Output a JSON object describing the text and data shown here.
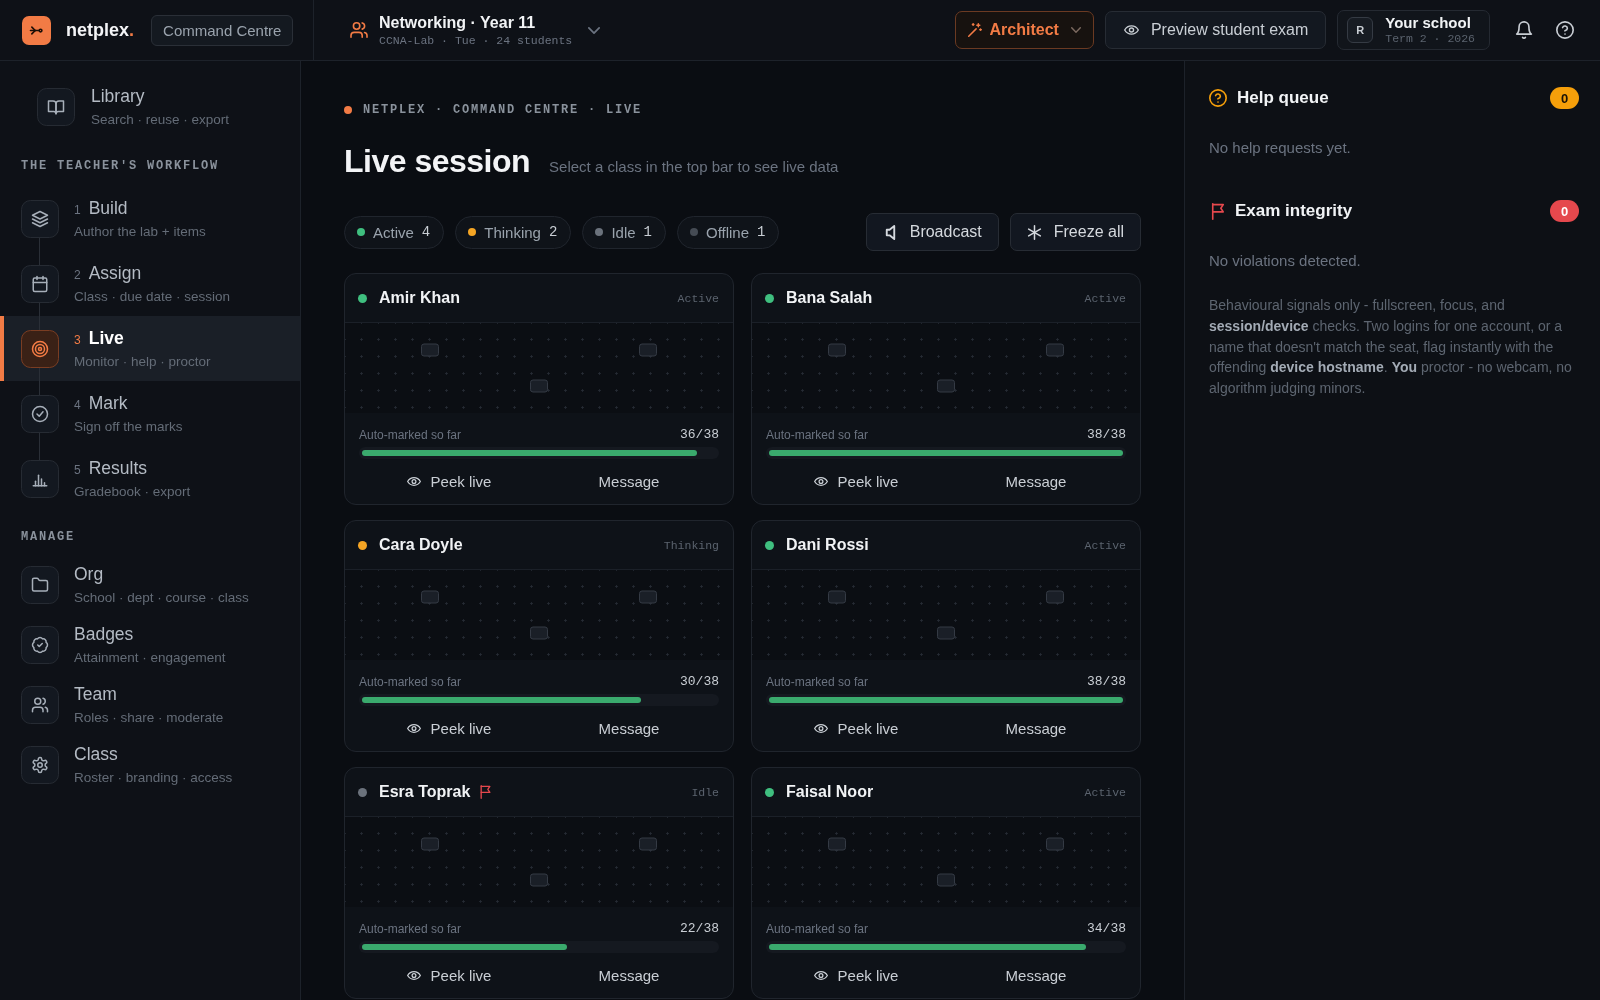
{
  "topbar": {
    "brand": "netplex",
    "brand_mark": ".",
    "section": "Command Centre",
    "class_picker": {
      "title": "Networking · Year 11",
      "subtitle": "CCNA-Lab · Tue · 24 students"
    },
    "role_button": "Architect",
    "preview_button": "Preview student exam",
    "school": {
      "avatar": "R",
      "name": "Your school",
      "term": "Term 2 · 2026"
    }
  },
  "sidebar": {
    "library": {
      "title": "Library",
      "subtitle": "Search · reuse · export",
      "selected": false
    },
    "workflow": {
      "heading": "THE TEACHER'S WORKFLOW",
      "items": [
        {
          "number": "1",
          "title": "Build",
          "subtitle": "Author the lab + items",
          "selected": false
        },
        {
          "number": "2",
          "title": "Assign",
          "subtitle": "Class · due date · session",
          "selected": false
        },
        {
          "number": "3",
          "title": "Live",
          "subtitle": "Monitor · help · proctor",
          "selected": true
        },
        {
          "number": "4",
          "title": "Mark",
          "subtitle": "Sign off the marks",
          "selected": false
        },
        {
          "number": "5",
          "title": "Results",
          "subtitle": "Gradebook · export",
          "selected": false
        }
      ]
    },
    "manage": {
      "heading": "MANAGE",
      "items": [
        {
          "title": "Org",
          "subtitle": "School · dept · course · class",
          "selected": false
        },
        {
          "title": "Badges",
          "subtitle": "Attainment · engagement",
          "selected": false
        },
        {
          "title": "Team",
          "subtitle": "Roles · share · moderate",
          "selected": false
        },
        {
          "title": "Class",
          "subtitle": "Roster · branding · access",
          "selected": false
        }
      ]
    }
  },
  "main": {
    "breadcrumb": "NETPLEX · COMMAND CENTRE · LIVE",
    "title": "Live session",
    "subtitle": "Select a class in the top bar to see live data",
    "filters": [
      {
        "label": "Active",
        "count": "4",
        "color": "#3fbf7f"
      },
      {
        "label": "Thinking",
        "count": "2",
        "color": "#f5a524"
      },
      {
        "label": "Idle",
        "count": "1",
        "color": "#6b727c"
      },
      {
        "label": "Offline",
        "count": "1",
        "color": "#454b54"
      }
    ],
    "actions": [
      "Broadcast",
      "Freeze all"
    ],
    "students": [
      {
        "name": "Amir Khan",
        "status": "Active",
        "color": "#3fbf7f",
        "flagged": false,
        "progress_label": "Auto-marked so far",
        "score": "36/38",
        "level": 0.947,
        "actions": [
          "Peek live",
          "Message"
        ]
      },
      {
        "name": "Bana Salah",
        "status": "Active",
        "color": "#3fbf7f",
        "flagged": false,
        "progress_label": "Auto-marked so far",
        "score": "38/38",
        "level": 1,
        "actions": [
          "Peek live",
          "Message"
        ]
      },
      {
        "name": "Cara Doyle",
        "status": "Thinking",
        "color": "#f5a524",
        "flagged": false,
        "progress_label": "Auto-marked so far",
        "score": "30/38",
        "level": 0.789,
        "actions": [
          "Peek live",
          "Message"
        ]
      },
      {
        "name": "Dani Rossi",
        "status": "Active",
        "color": "#3fbf7f",
        "flagged": false,
        "progress_label": "Auto-marked so far",
        "score": "38/38",
        "level": 1,
        "actions": [
          "Peek live",
          "Message"
        ]
      },
      {
        "name": "Esra Toprak",
        "status": "Idle",
        "color": "#6b727c",
        "flagged": true,
        "progress_label": "Auto-marked so far",
        "score": "22/38",
        "level": 0.579,
        "actions": [
          "Peek live",
          "Message"
        ]
      },
      {
        "name": "Faisal Noor",
        "status": "Active",
        "color": "#3fbf7f",
        "flagged": false,
        "progress_label": "Auto-marked so far",
        "score": "34/38",
        "level": 0.895,
        "actions": [
          "Peek live",
          "Message"
        ]
      }
    ]
  },
  "panel": {
    "help_queue": {
      "title": "Help queue",
      "count": "0",
      "empty": "No help requests yet."
    },
    "integrity": {
      "title": "Exam integrity",
      "count": "0",
      "empty": "No violations detected.",
      "note": "Behavioural signals only - fullscreen, focus, and **session/device** checks. Two logins for one account, or a name that doesn't match the seat, flag instantly with the offending **device hostname**. **You** proctor - no webcam, no algorithm judging minors."
    }
  }
}
